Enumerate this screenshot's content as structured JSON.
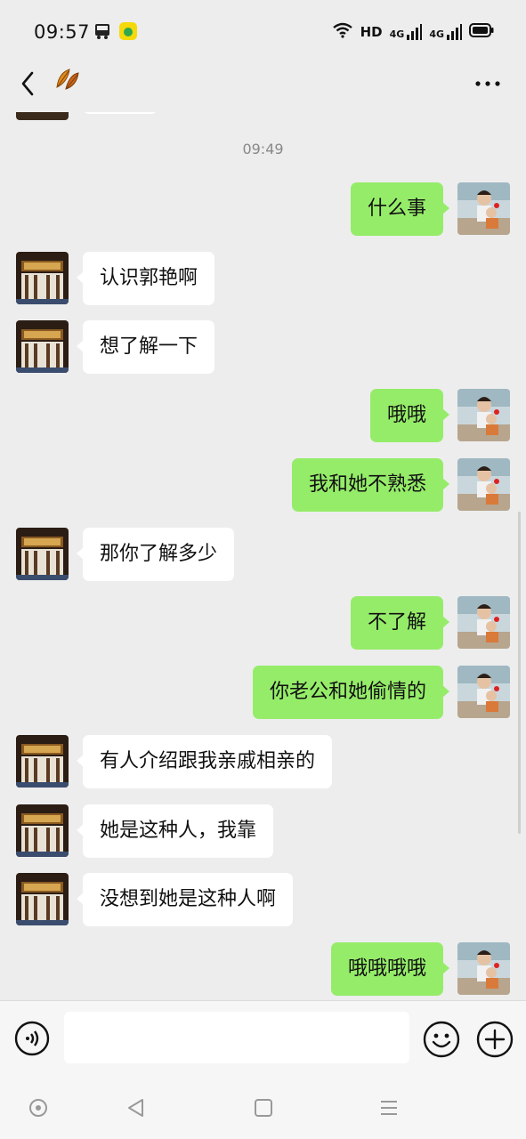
{
  "status_bar": {
    "time": "09:57",
    "network_label": "HD",
    "signal1_label": "4G",
    "signal2_label": "4G",
    "icons": [
      "bus-icon",
      "app-icon",
      "wifi-icon",
      "signal-icon",
      "battery-icon"
    ]
  },
  "nav": {
    "back_icon": "chevron-left-icon",
    "logo_icon": "leaves-icon",
    "more_icon": "more-dots-icon"
  },
  "chat": {
    "timestamp": "09:49",
    "messages": [
      {
        "side": "out",
        "text": "什么事"
      },
      {
        "side": "in",
        "text": "认识郭艳啊"
      },
      {
        "side": "in",
        "text": "想了解一下"
      },
      {
        "side": "out",
        "text": "哦哦"
      },
      {
        "side": "out",
        "text": "我和她不熟悉"
      },
      {
        "side": "in",
        "text": "那你了解多少"
      },
      {
        "side": "out",
        "text": "不了解"
      },
      {
        "side": "out",
        "text": "你老公和她偷情的"
      },
      {
        "side": "in",
        "text": "有人介绍跟我亲戚相亲的"
      },
      {
        "side": "in",
        "text": "她是这种人，我靠"
      },
      {
        "side": "in",
        "text": "没想到她是这种人啊"
      },
      {
        "side": "out",
        "text": "哦哦哦哦"
      }
    ]
  },
  "input_bar": {
    "placeholder": "",
    "icons": [
      "voice-icon",
      "emoji-icon",
      "plus-icon"
    ]
  },
  "colors": {
    "outgoing_bubble": "#95ec69",
    "incoming_bubble": "#ffffff",
    "background": "#ededed"
  }
}
